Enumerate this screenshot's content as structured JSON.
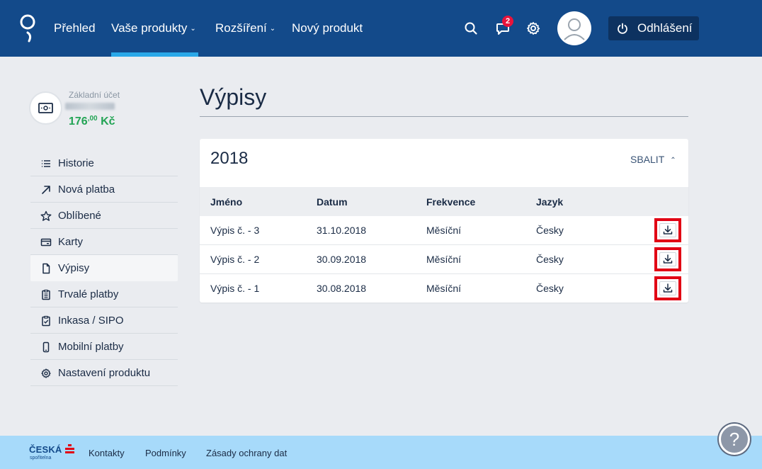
{
  "header": {
    "nav": [
      {
        "label": "Přehled"
      },
      {
        "label": "Vaše produkty",
        "chevron": "⌄"
      },
      {
        "label": "Rozšíření",
        "chevron": "⌄"
      },
      {
        "label": "Nový produkt"
      }
    ],
    "notification_count": "2",
    "logout_label": "Odhlášení",
    "colors": {
      "bar": "#134a8a",
      "active_underline": "#2aa8e8",
      "badge": "#e8133b"
    }
  },
  "account": {
    "label": "Základní účet",
    "balance_whole": "176",
    "balance_decimal": ",00",
    "currency": "Kč"
  },
  "sidebar": {
    "items": [
      {
        "label": "Historie",
        "icon": "list-icon"
      },
      {
        "label": "Nová platba",
        "icon": "arrow-up-right-icon"
      },
      {
        "label": "Oblíbené",
        "icon": "star-icon"
      },
      {
        "label": "Karty",
        "icon": "card-icon"
      },
      {
        "label": "Výpisy",
        "icon": "document-icon",
        "active": true
      },
      {
        "label": "Trvalé platby",
        "icon": "clipboard-icon"
      },
      {
        "label": "Inkasa / SIPO",
        "icon": "clipboard-check-icon"
      },
      {
        "label": "Mobilní platby",
        "icon": "phone-icon"
      },
      {
        "label": "Nastavení produktu",
        "icon": "gear-icon"
      }
    ]
  },
  "main": {
    "title": "Výpisy",
    "card": {
      "year": "2018",
      "collapse_label": "SBALIT",
      "columns": [
        "Jméno",
        "Datum",
        "Frekvence",
        "Jazyk"
      ],
      "rows": [
        {
          "name": "Výpis č. - 3",
          "date": "31.10.2018",
          "frequency": "Měsíční",
          "language": "Česky"
        },
        {
          "name": "Výpis č. - 2",
          "date": "30.09.2018",
          "frequency": "Měsíční",
          "language": "Česky"
        },
        {
          "name": "Výpis č. - 1",
          "date": "30.08.2018",
          "frequency": "Měsíční",
          "language": "Česky"
        }
      ]
    }
  },
  "footer": {
    "logo_text": "ČESKÁ",
    "logo_subtext": "spořitelna",
    "links": [
      "Kontakty",
      "Podmínky",
      "Zásady ochrany dat"
    ],
    "help": "?"
  }
}
